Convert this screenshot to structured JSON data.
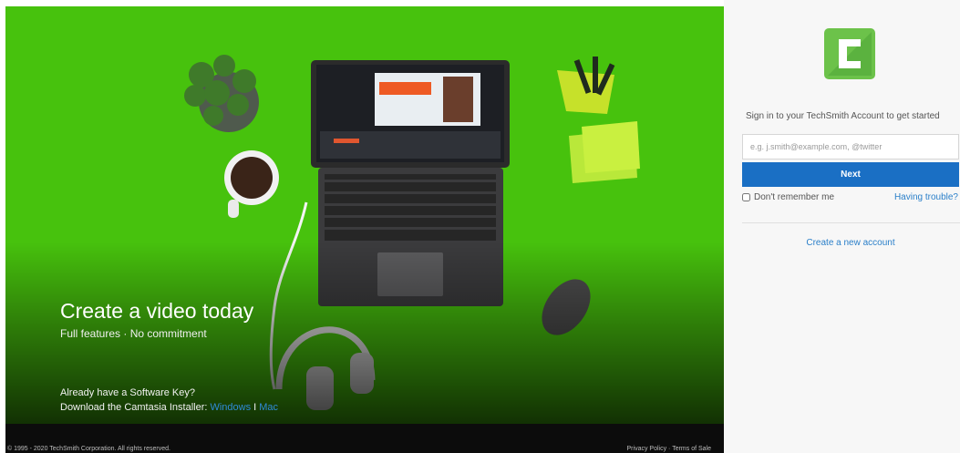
{
  "hero": {
    "title": "Create a video today",
    "subtitle": "Full features · No commitment",
    "software_key": "Already have a Software Key?",
    "installer_prefix": "Download the Camtasia Installer: ",
    "installer_windows": "Windows",
    "installer_sep": " I ",
    "installer_mac": "Mac"
  },
  "footer": {
    "copyright": "© 1995 - 2020 TechSmith Corporation. All rights reserved.",
    "privacy": "Privacy Policy",
    "link_sep": " · ",
    "terms": "Terms of Sale"
  },
  "signin": {
    "logo_icon": "camtasia-logo-icon",
    "prompt": "Sign in to your TechSmith Account to get started",
    "email_placeholder": "e.g. j.smith@example.com, @twitter",
    "next_label": "Next",
    "remember_label": "Don't remember me",
    "trouble_label": "Having trouble?",
    "create_label": "Create a new account"
  },
  "colors": {
    "hero_green": "#49c40e",
    "button_blue": "#1a6fc4",
    "link_blue": "#2a7fc9",
    "logo_green": "#6cc24a"
  }
}
